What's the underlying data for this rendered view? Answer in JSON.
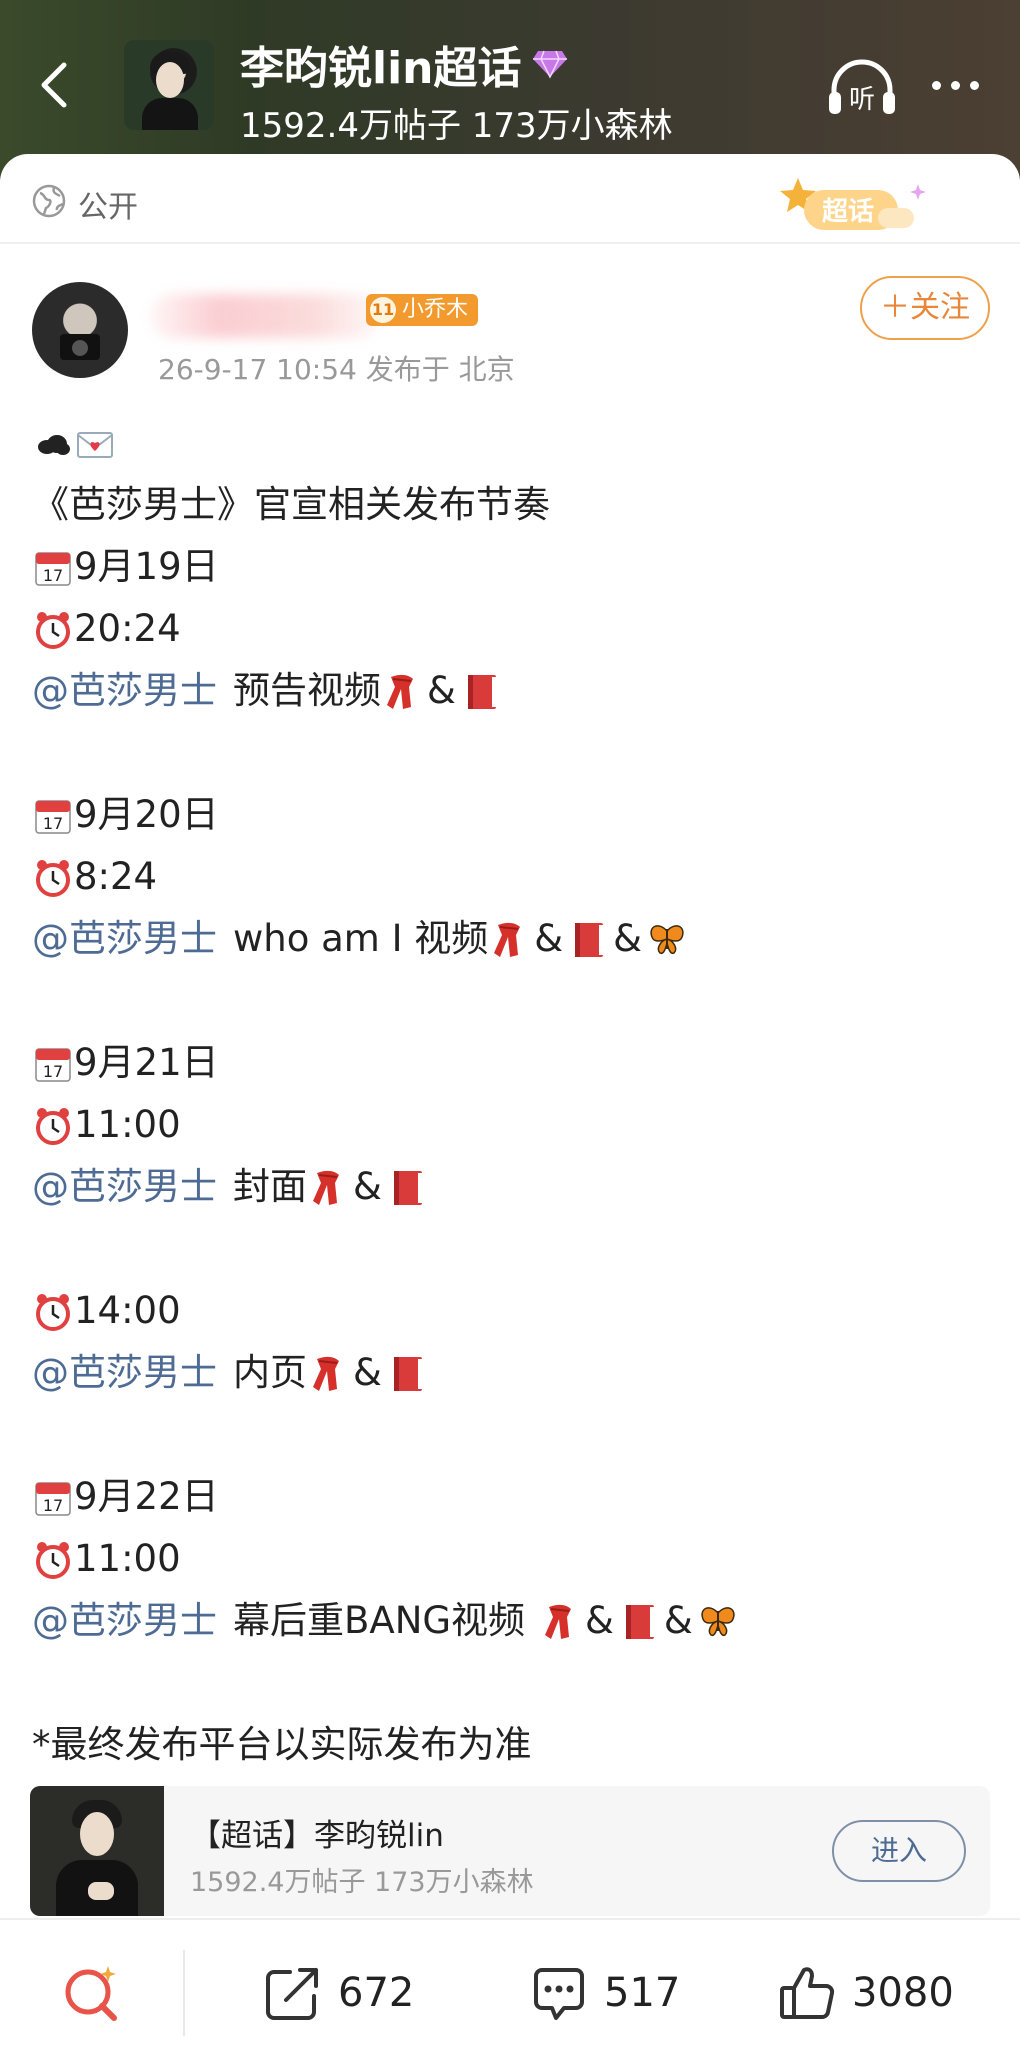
{
  "header": {
    "title": "李昀锐lin超话",
    "subtitle": "1592.4万帖子 173万小森林",
    "listen_label": "听"
  },
  "post": {
    "visibility": "公开",
    "topic_badge": "超话",
    "author_level": "11",
    "author_badge": "小乔木",
    "meta": "26-9-17 10:54  发布于 北京",
    "follow_label": "＋关注",
    "headline": "《芭莎男士》官宣相关发布节奏",
    "schedule": [
      {
        "date": "9月19日",
        "time": "20:24",
        "mention": "@芭莎男士",
        "text": "预告视频"
      },
      {
        "date": "9月20日",
        "time": "8:24",
        "mention": "@芭莎男士",
        "text": "who am I 视频"
      },
      {
        "date": "9月21日",
        "time": "11:00",
        "mention": "@芭莎男士",
        "text": "封面"
      },
      {
        "time": "14:00",
        "mention": "@芭莎男士",
        "text": "内页"
      },
      {
        "date": "9月22日",
        "time": "11:00",
        "mention": "@芭莎男士",
        "text": "幕后重BANG视频"
      }
    ],
    "amp": "&",
    "note": "*最终发布平台以实际发布为准"
  },
  "topic_card": {
    "title": "【超话】李昀锐lin",
    "subtitle": "1592.4万帖子 173万小森林",
    "enter_label": "进入"
  },
  "actions": {
    "share_count": "672",
    "comment_count": "517",
    "like_count": "3080"
  },
  "colors": {
    "mention": "#4d6b93",
    "follow": "#e8863a",
    "accent_red": "#e04040"
  }
}
